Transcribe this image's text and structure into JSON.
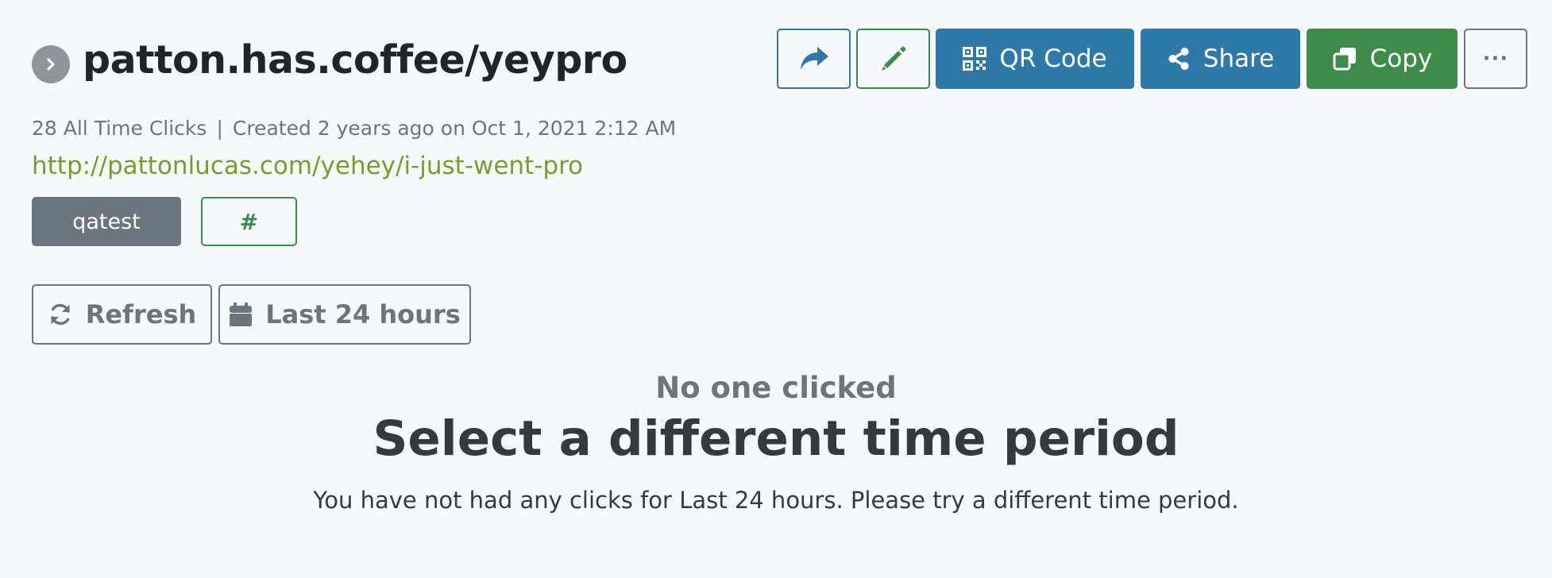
{
  "link": {
    "short_url": "patton.has.coffee/yeypro",
    "clicks_text": "28 All Time Clicks",
    "separator": "|",
    "created_text": "Created 2 years ago on Oct 1, 2021 2:12 AM",
    "destination_url": "http://pattonlucas.com/yehey/i-just-went-pro",
    "tag": "qatest",
    "hash_label": "#"
  },
  "toolbar": {
    "qr_label": "QR Code",
    "share_label": "Share",
    "copy_label": "Copy",
    "more_label": "···"
  },
  "controls": {
    "refresh_label": "Refresh",
    "range_label": "Last 24 hours"
  },
  "empty_state": {
    "subtitle": "No one clicked",
    "title": "Select a different time period",
    "message": "You have not had any clicks for Last 24 hours. Please try a different time period."
  },
  "colors": {
    "primary_blue": "#2f79a8",
    "success_green": "#3e8b4a",
    "url_green": "#7d9a32",
    "secondary_gray": "#6c757d",
    "background": "#f6f8fb"
  },
  "icons": {
    "expand": "chevron-right-icon",
    "redirect": "share-arrow-icon",
    "edit": "pencil-icon",
    "qr": "qr-code-icon",
    "share": "share-nodes-icon",
    "copy": "copy-icon",
    "refresh": "refresh-icon",
    "range": "calendar-icon"
  }
}
